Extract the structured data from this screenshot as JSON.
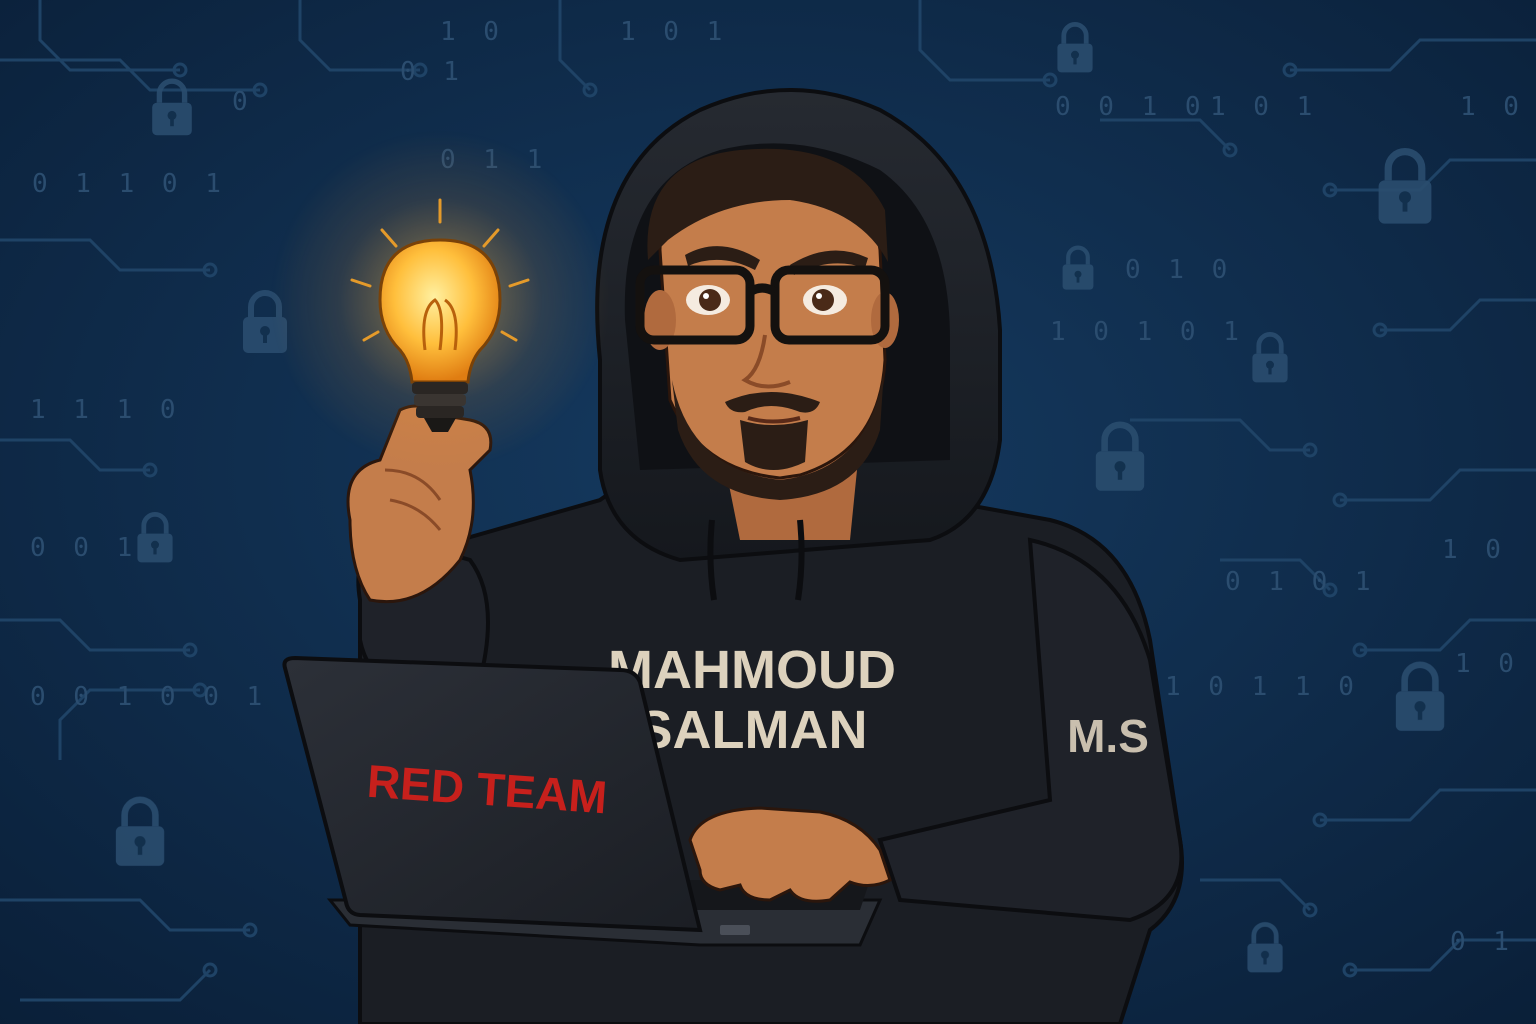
{
  "scene": {
    "background_color": "#0d2745",
    "accent_color": "#c7201c",
    "bulb_color": "#ffb23a",
    "hoodie_color": "#1b1e24"
  },
  "hoodie": {
    "name_line1": "MAHMOUD",
    "name_line2": "SALMAN",
    "sleeve_initials": "M.S"
  },
  "laptop": {
    "lid_text": "RED TEAM"
  },
  "background_binary": [
    "0 1 1 0 1",
    "1 1 1 0",
    "0 0 1",
    "0 0 1 0 0 1",
    "1 0",
    "0 1",
    "1 0 1",
    "0 1 1",
    "0",
    "0 0 1 0",
    "1 0 1",
    "1 0",
    "0 1 0",
    "1 0 1 0 1",
    "0 1 0 1",
    "1 0",
    "1 0 1",
    "1 0 1 1 0",
    "0 1 1"
  ],
  "icons": [
    "padlock-icon",
    "lightbulb-icon",
    "laptop-icon"
  ]
}
